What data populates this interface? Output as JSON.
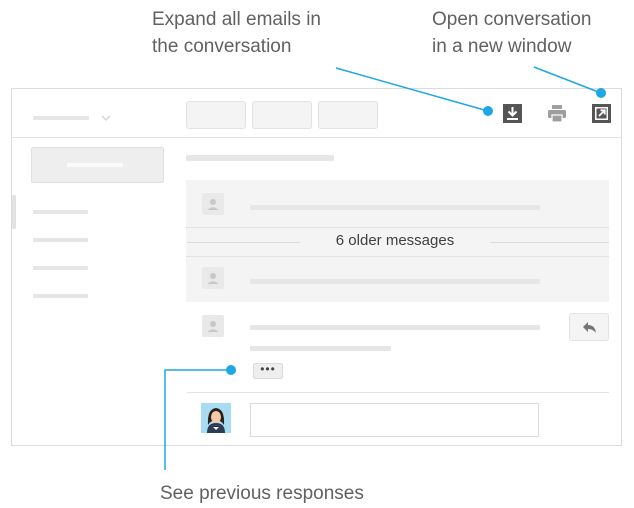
{
  "callouts": {
    "expand_all": "Expand all emails in\nthe conversation",
    "open_new_window": "Open conversation\nin a new window",
    "previous_responses": "See previous responses"
  },
  "thread": {
    "older_messages_label": "6 older messages",
    "collapsed_quote": "•••"
  },
  "icons": {
    "expand": "expand-all-icon",
    "print": "print-icon",
    "open": "open-in-new-window-icon",
    "reply": "reply-icon",
    "person": "person-icon",
    "user_avatar": "user-avatar-icon",
    "chevron": "chevron-down-icon"
  },
  "colors": {
    "accent": "#1ea7e4",
    "icon_dark": "#555555",
    "skeleton": "#e6e6e6"
  }
}
